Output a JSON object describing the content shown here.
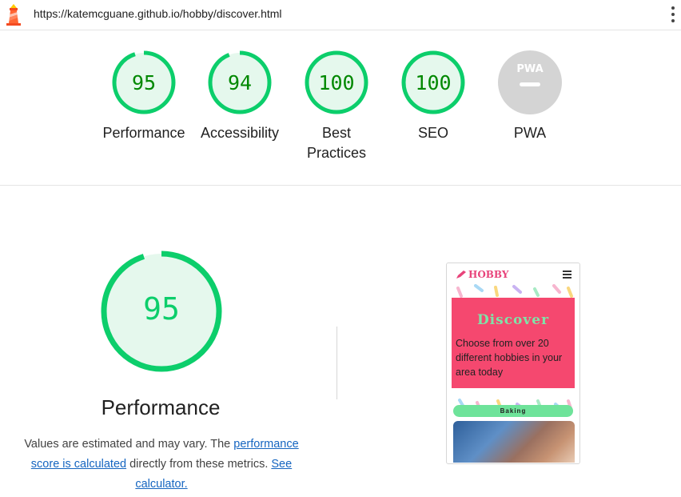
{
  "url": "https://katemcguane.github.io/hobby/discover.html",
  "gauges": [
    {
      "score": 95,
      "label": "Performance",
      "color": "#0cce6b"
    },
    {
      "score": 94,
      "label": "Accessibility",
      "color": "#0cce6b"
    },
    {
      "score": 100,
      "label": "Best Practices",
      "color": "#0cce6b"
    },
    {
      "score": 100,
      "label": "SEO",
      "color": "#0cce6b"
    },
    {
      "score": null,
      "label": "PWA",
      "badge": "PWA",
      "color": "#cccccc"
    }
  ],
  "performance": {
    "score": 95,
    "title": "Performance",
    "desc_prefix": "Values are estimated and may vary. The ",
    "link1": "performance score is calculated",
    "desc_mid": " directly from these metrics. ",
    "link2": "See calculator."
  },
  "thumbnail": {
    "brand": "HOBBY",
    "hero_title": "Discover",
    "hero_text": "Choose from over 20 different hobbies in your area today",
    "button": "Baking"
  }
}
